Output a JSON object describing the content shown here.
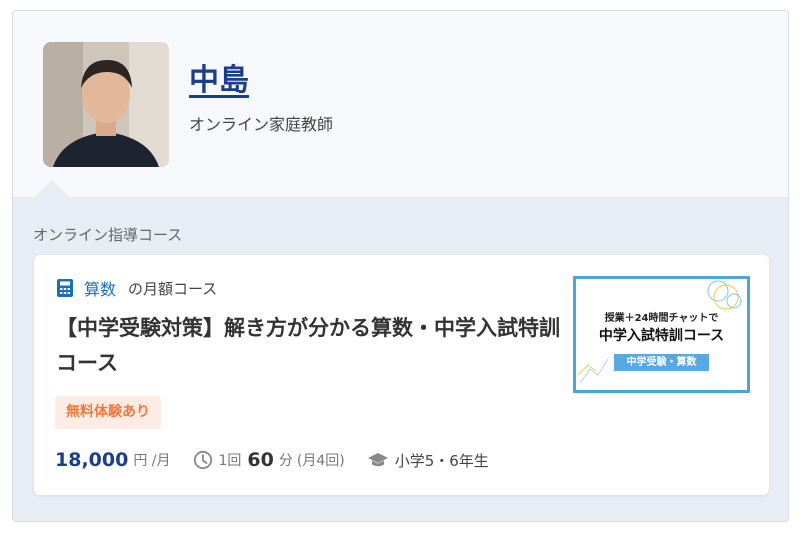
{
  "tutor": {
    "name": "中島",
    "role": "オンライン家庭教師"
  },
  "section": {
    "label": "オンライン指導コース"
  },
  "course": {
    "subject": "算数",
    "plan_type": "の月額コース",
    "title": "【中学受験対策】解き方が分かる算数・中学入試特訓コース",
    "trial_badge": "無料体験あり",
    "price": "18,000",
    "price_unit": "円 /月",
    "lesson_count_label": "1回",
    "minutes": "60",
    "minutes_unit": "分",
    "frequency": "(月4回)",
    "grade": "小学5・6年生",
    "thumbnail": {
      "line1": "授業＋24時間チャットで",
      "line2": "中学入試特訓コース",
      "tag": "中学受験・算数"
    }
  },
  "colors": {
    "name_link": "#1a3e8c",
    "subject_accent": "#1a6fbd",
    "trial_badge_bg": "#fdece4",
    "trial_badge_text": "#f07a3c",
    "thumb_border": "#4ea3db"
  },
  "icons": {
    "subject": "calculator-icon",
    "duration": "clock-icon",
    "grade": "graduation-cap-icon"
  }
}
